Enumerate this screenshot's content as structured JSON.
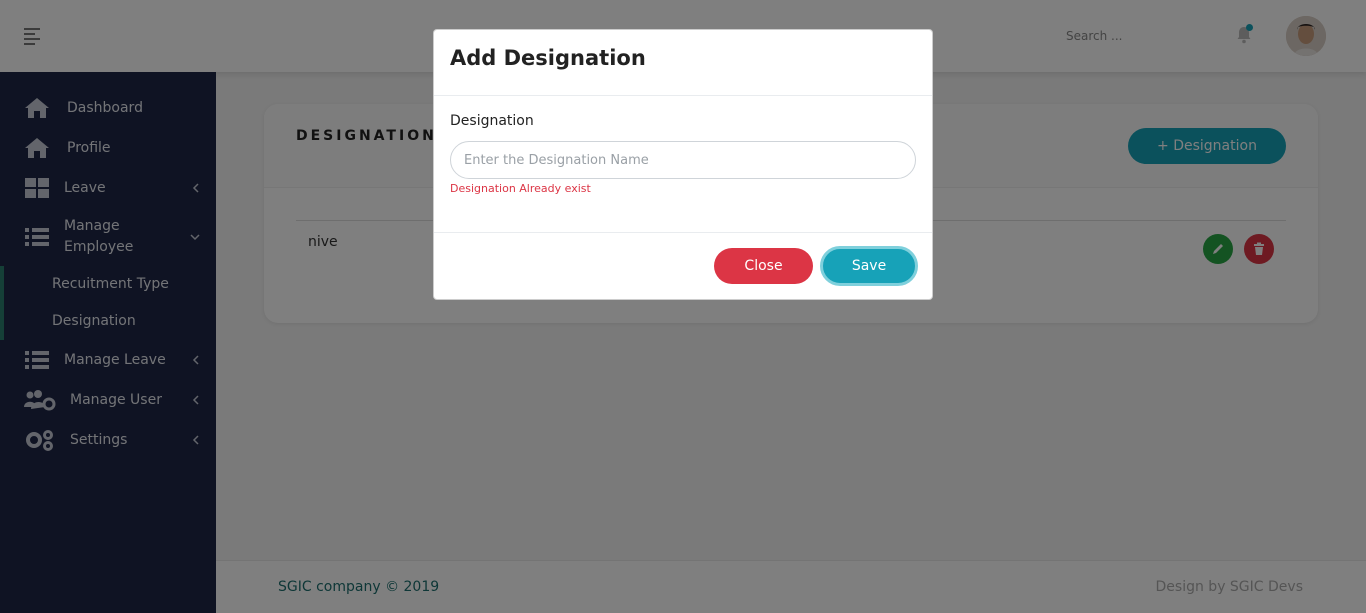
{
  "header": {
    "search_placeholder": "Search ...",
    "menu_icon": "hamburger-icon",
    "bell_icon": "bell-icon",
    "notification_dot_color": "#17a2b8"
  },
  "sidebar": {
    "items": [
      {
        "label": "Dashboard",
        "icon": "home-icon"
      },
      {
        "label": "Profile",
        "icon": "home-icon"
      },
      {
        "label": "Leave",
        "icon": "grid-icon"
      },
      {
        "label": "Manage Employee",
        "icon": "list-icon"
      },
      {
        "label": "Manage Leave",
        "icon": "list-icon"
      },
      {
        "label": "Manage User",
        "icon": "users-gear-icon"
      },
      {
        "label": "Settings",
        "icon": "gears-icon"
      }
    ],
    "sub_items": [
      {
        "label": "Recuitment Type"
      },
      {
        "label": "Designation"
      }
    ]
  },
  "page": {
    "title": "DESIGNATION",
    "add_button_label": "+ Designation",
    "rows": [
      {
        "name": "nive"
      }
    ]
  },
  "footer": {
    "left": "SGIC company © 2019",
    "right": "Design by SGIC Devs"
  },
  "modal": {
    "title": "Add Designation",
    "field_label": "Designation",
    "field_placeholder": "Enter the Designation Name",
    "field_value": "",
    "error": "Designation Already exist",
    "close_label": "Close",
    "save_label": "Save"
  },
  "colors": {
    "sidebar_bg": "#1e2747",
    "accent": "#17a2b8",
    "danger": "#dc3545",
    "success": "#28a745"
  }
}
